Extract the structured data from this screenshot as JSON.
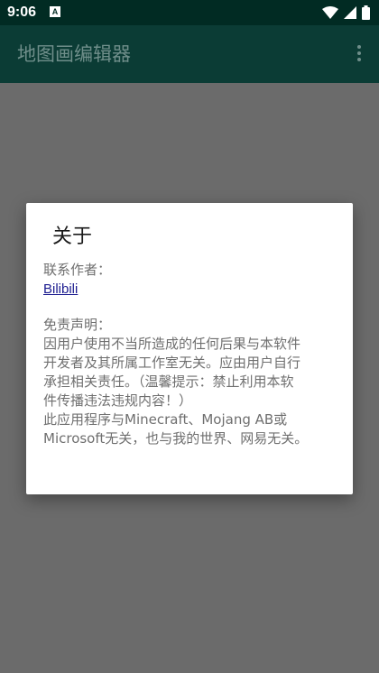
{
  "status_bar": {
    "time": "9:06",
    "notification_icon_letter": "A",
    "icons": [
      "wifi-icon",
      "signal-icon",
      "battery-icon"
    ]
  },
  "app_bar": {
    "title": "地图画编辑器",
    "overflow_icon": "more-vert-icon"
  },
  "dialog": {
    "title": "关于",
    "contact_label": "联系作者：",
    "contact_link": "Bilibili",
    "disclaimer_label": "免责声明：",
    "disclaimer_lines": [
      "因用户使用不当所造成的任何后果与本软件",
      "开发者及其所属工作室无关。应由用户自行",
      "承担相关责任。（温馨提示：禁止利用本软",
      "件传播违法违规内容！）",
      "此应用程序与Minecraft、Mojang AB或",
      "Microsoft无关，也与我的世界、网易无关。"
    ]
  },
  "colors": {
    "status_bar": "#012b23",
    "app_bar": "#0b3c35",
    "scrim_background": "#6b6b6b",
    "dialog_background": "#ffffff",
    "link": "#1b1b8f"
  }
}
